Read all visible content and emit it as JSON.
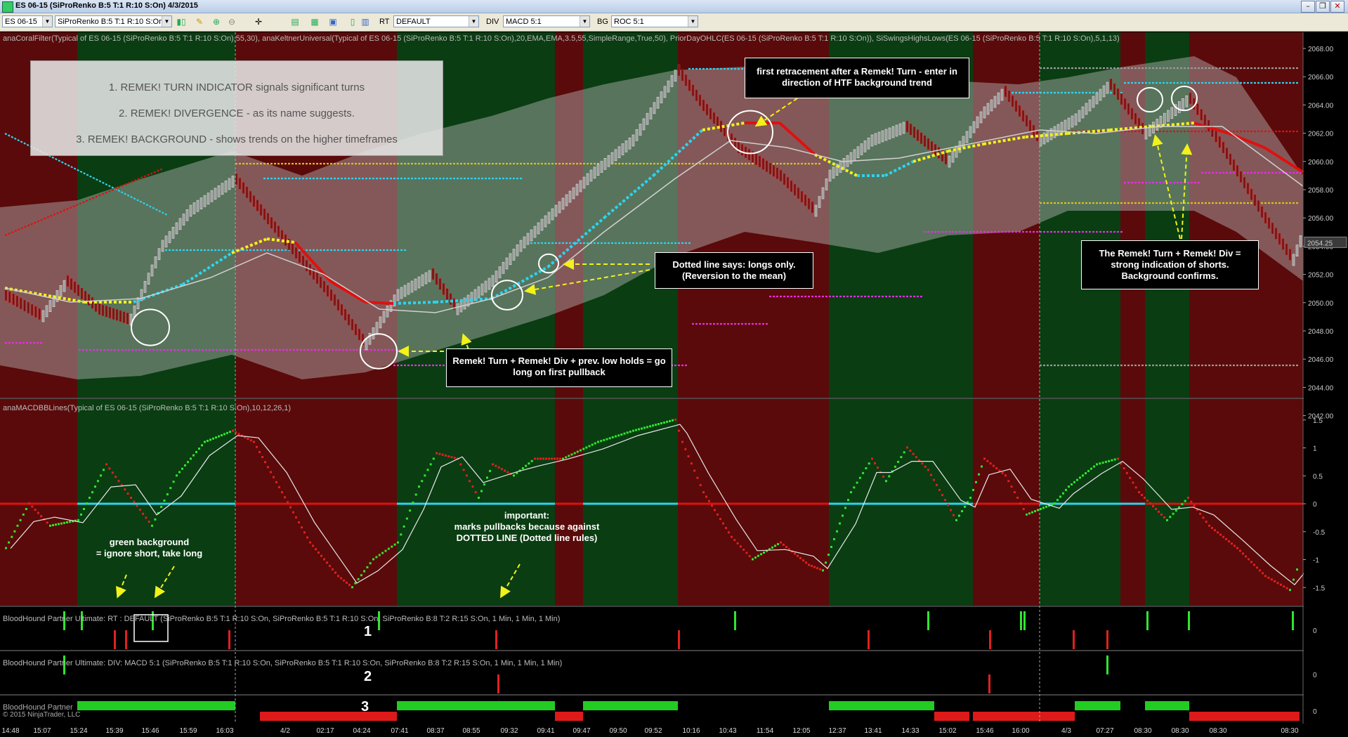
{
  "window": {
    "title": "ES 06-15 (SiProRenko B:5 T:1 R:10 S:On)  4/3/2015",
    "buttons": [
      "–",
      "❐",
      "✕"
    ]
  },
  "toolbar": {
    "instrument": "ES 06-15",
    "bartype": "SiProRenko B:5 T:1 R:10 S:On",
    "rt_label": "RT",
    "rt_value": "DEFAULT",
    "div_label": "DIV",
    "div_value": "MACD 5:1",
    "bg_label": "BG",
    "bg_value": "ROC 5:1"
  },
  "indicators": {
    "price_panel": "anaCoralFilter(Typical of ES 06-15 (SiProRenko B:5 T:1 R:10 S:On),55,30), anaKeltnerUniversal(Typical of ES 06-15 (SiProRenko B:5 T:1 R:10 S:On),20,EMA,EMA,3.5,55,SimpleRange,True,50), PriorDayOHLC(ES 06-15 (SiProRenko B:5 T:1 R:10 S:On)), SiSwingsHighsLows(ES 06-15 (SiProRenko B:5 T:1 R:10 S:On),5,1,13)",
    "macd_panel": "anaMACDBBLines(Typical of ES 06-15 (SiProRenko B:5 T:1 R:10 S:On),10,12,26,1)",
    "bh_rt": "BloodHound Partner Ultimate: RT : DEFAULT (SiProRenko B:5 T:1 R:10 S:On, SiProRenko B:5 T:1 R:10 S:On, SiProRenko B:8 T:2 R:15 S:On, 1 Min, 1 Min, 1 Min)",
    "bh_div": "BloodHound Partner Ultimate: DIV: MACD 5:1 (SiProRenko B:5 T:1 R:10 S:On, SiProRenko B:5 T:1 R:10 S:On, SiProRenko B:8 T:2 R:15 S:On, 1 Min, 1 Min, 1 Min)",
    "bh_bg": "BloodHound Partner",
    "copyright": "© 2015 NinjaTrader, LLC"
  },
  "infobox": {
    "line1": "1. REMEK! TURN INDICATOR signals significant turns",
    "line2": "2. REMEK! DIVERGENCE - as its name suggests.",
    "line3": "3. REMEK! BACKGROUND - shows trends on the higher timeframes"
  },
  "annotations": {
    "first_retracement": "first retracement after a Remek! Turn - enter in direction of HTF background trend",
    "dotted_line": "Dotted line says: longs only. (Reversion to the mean)",
    "remek_turn_long": "Remek! Turn + Remek! Div + prev. low holds = go long on first pullback",
    "remek_shorts": "The Remek! Turn + Remek! Div = strong indication of shorts. Background confirms.",
    "important": "important:\nmarks pullbacks because against\nDOTTED LINE (Dotted line rules)",
    "green_bg": "green background\n= ignore short, take long"
  },
  "panel_numbers": [
    "1",
    "2",
    "3"
  ],
  "price_axis": [
    "2068.00",
    "2066.00",
    "2064.00",
    "2062.00",
    "2060.00",
    "2058.00",
    "2056.00",
    "2054.00",
    "2052.00",
    "2050.00",
    "2048.00",
    "2046.00",
    "2044.00",
    "2042.00"
  ],
  "current_price": "2054.25",
  "macd_axis": [
    "1.5",
    "1",
    "0.5",
    "0",
    "-0.5",
    "-1",
    "-1.5"
  ],
  "bh_axis": [
    "0",
    "0",
    "0"
  ],
  "time_axis": [
    "14:48",
    "15:07",
    "15:24",
    "15:39",
    "15:46",
    "15:59",
    "16:03",
    "4/2",
    "02:17",
    "04:24",
    "07:41",
    "08:37",
    "08:55",
    "09:32",
    "09:41",
    "09:47",
    "09:50",
    "09:52",
    "10:16",
    "10:43",
    "11:54",
    "12:05",
    "12:37",
    "13:41",
    "14:33",
    "15:02",
    "15:46",
    "16:00",
    "4/3",
    "07:27",
    "08:30",
    "08:30",
    "08:30",
    "08:30"
  ],
  "colors": {
    "bg_red": "#5a0a0a",
    "bg_green": "#0a3d12",
    "band": "#b7b7b7",
    "cyan": "#2bd4f0",
    "yellow": "#f2f21a",
    "magenta": "#e62ee6",
    "red_line": "#e01010",
    "green_dot": "#2ee62e"
  }
}
